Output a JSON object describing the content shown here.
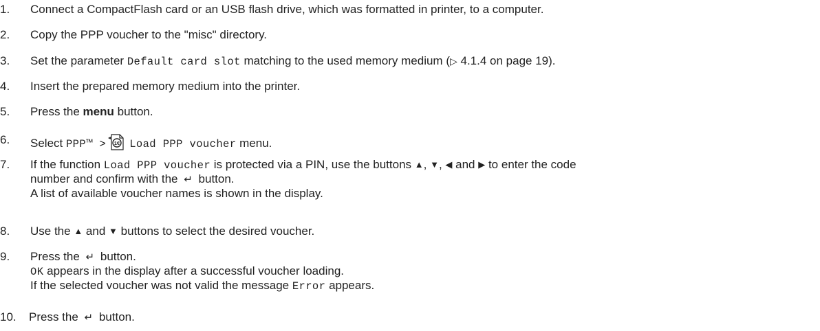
{
  "steps": [
    {
      "num": "1.",
      "text": "Connect a CompactFlash card or an USB flash drive, which was formatted in printer, to a computer."
    },
    {
      "num": "2.",
      "text": "Copy the PPP voucher to the \"misc\" directory."
    },
    {
      "num": "3.",
      "pre": "Set the parameter ",
      "code": "Default card slot",
      "post": " matching to the used memory medium (",
      "ref_arrow": "▷",
      "ref": " 4.1.4 on page 19)."
    },
    {
      "num": "4.",
      "text": "Insert the prepared memory medium into the printer."
    },
    {
      "num": "5.",
      "pre": "Press the ",
      "bold": "menu",
      "post": " button."
    },
    {
      "num": "6.",
      "pre": "Select ",
      "code1": "PPP™ >",
      "code2": "Load PPP voucher",
      "post": " menu."
    },
    {
      "num": "7.",
      "pre": "If the function ",
      "code": "Load PPP voucher",
      "mid": " is protected via a PIN, use the buttons ",
      "and": " and ",
      "tail": " to enter the code",
      "line2": "number and confirm with the",
      "line2_end": "button.",
      "line3": "A list of available voucher names is shown in the display."
    },
    {
      "num": "8.",
      "pre": "Use the ",
      "and": "and",
      "post": "buttons to select the desired voucher."
    },
    {
      "num": "9.",
      "pre": "Press the",
      "post": "button.",
      "ok_code": "OK",
      "ok_text": " appears in the display after a successful voucher loading.",
      "err_pre": "If the selected voucher was not valid the message ",
      "err_code": "Error",
      "err_post": " appears."
    },
    {
      "num": "10.",
      "pre": "Press the",
      "post": "button."
    }
  ],
  "icons": {
    "up": "▲",
    "down": "▼",
    "left": "◀",
    "right": "▶",
    "enter": "↵",
    "voucher": "voucher-icon",
    "voucher_label": "1€"
  }
}
